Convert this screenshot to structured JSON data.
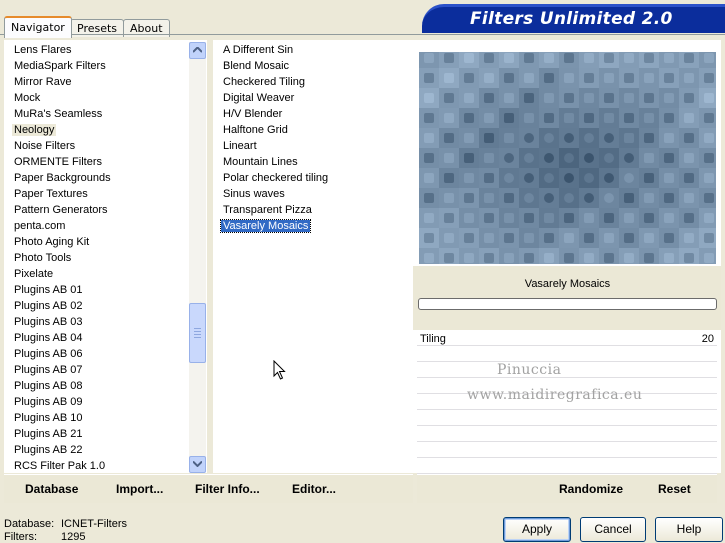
{
  "tabs": [
    "Navigator",
    "Presets",
    "About"
  ],
  "banner_title": "Filters Unlimited 2.0",
  "categories": [
    "Lens Flares",
    "MediaSpark Filters",
    "Mirror Rave",
    "Mock",
    "MuRa's Seamless",
    "Neology",
    "Noise Filters",
    "ORMENTE Filters",
    "Paper Backgrounds",
    "Paper Textures",
    "Pattern Generators",
    "penta.com",
    "Photo Aging Kit",
    "Photo Tools",
    "Pixelate",
    "Plugins AB 01",
    "Plugins AB 02",
    "Plugins AB 03",
    "Plugins AB 04",
    "Plugins AB 06",
    "Plugins AB 07",
    "Plugins AB 08",
    "Plugins AB 09",
    "Plugins AB 10",
    "Plugins AB 21",
    "Plugins AB 22",
    "RCS Filter Pak 1.0"
  ],
  "selected_category": "Neology",
  "filters": [
    "A Different Sin",
    "Blend Mosaic",
    "Checkered Tiling",
    "Digital Weaver",
    "H/V Blender",
    "Halftone Grid",
    "Lineart",
    "Mountain Lines",
    "Polar checkered tiling",
    "Sinus waves",
    "Transparent Pizza",
    "Vasarely Mosaics"
  ],
  "selected_filter": "Vasarely Mosaics",
  "left_bar": {
    "database": "Database",
    "import": "Import...",
    "filter_info": "Filter Info...",
    "editor": "Editor..."
  },
  "right_bar": {
    "randomize": "Randomize",
    "reset": "Reset"
  },
  "filter_name": "Vasarely Mosaics",
  "params": [
    {
      "label": "Tiling",
      "value": "20"
    }
  ],
  "watermark": {
    "line1": "Pinuccia",
    "line2": "www.maidiregrafica.eu"
  },
  "footer": {
    "database_label": "Database:",
    "database_value": "ICNET-Filters",
    "filters_label": "Filters:",
    "filters_value": "1295"
  },
  "buttons": {
    "apply": "Apply",
    "cancel": "Cancel",
    "help": "Help"
  },
  "colors": {
    "banner": "#0b2d9c",
    "selection": "#316ac5",
    "preview_base": "#5f7d9c"
  },
  "scroll_position": 0.72
}
